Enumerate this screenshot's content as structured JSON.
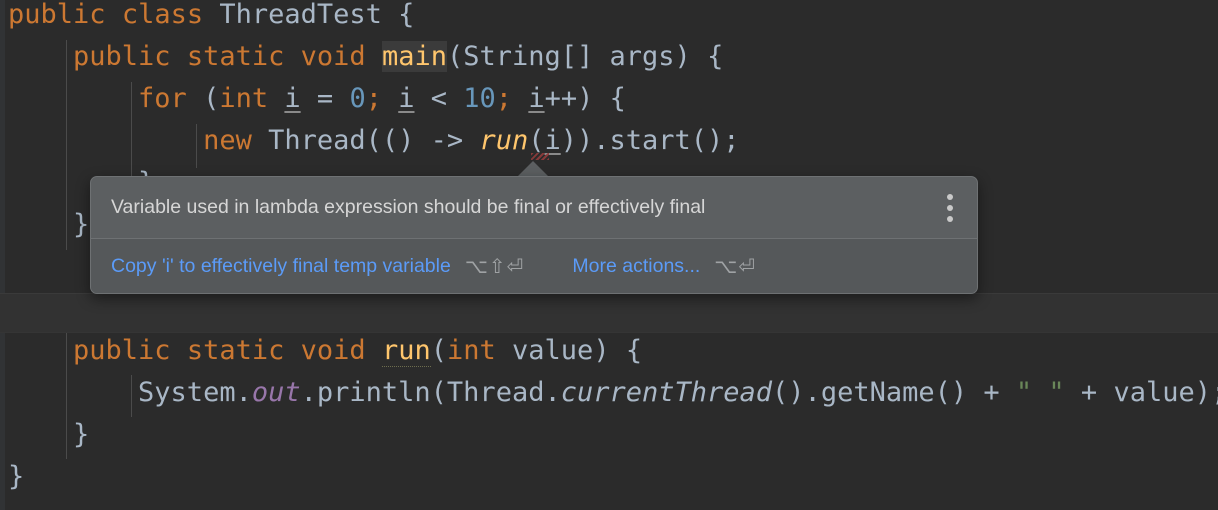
{
  "editor": {
    "background_color": "#2b2b2b",
    "font_size_px": 27,
    "language": "Java",
    "lines": [
      {
        "id": "line-1",
        "indent": 0,
        "text": "public class ThreadTest {"
      },
      {
        "id": "line-2",
        "indent": 1,
        "text": "public static void main(String[] args) {"
      },
      {
        "id": "line-3",
        "indent": 2,
        "text": "for (int i = 0; i < 10; i++) {"
      },
      {
        "id": "line-4",
        "indent": 3,
        "text": "new Thread(() -> run(i)).start();"
      },
      {
        "id": "line-5",
        "indent": 2,
        "text": "}"
      },
      {
        "id": "line-6",
        "indent": 1,
        "text": "}"
      },
      {
        "id": "line-7",
        "indent": 0,
        "text": ""
      },
      {
        "id": "line-8",
        "indent": 1,
        "text": "public static void run(int value) {"
      },
      {
        "id": "line-9",
        "indent": 2,
        "text": "System.out.println(Thread.currentThread().getName() + \" \" + value);"
      },
      {
        "id": "line-10",
        "indent": 1,
        "text": "}"
      },
      {
        "id": "line-11",
        "indent": 0,
        "text": "}"
      }
    ],
    "tokens": {
      "line1": {
        "kw1": "public",
        "kw2": "class",
        "name": "ThreadTest",
        "brace": "{"
      },
      "line2": {
        "kw1": "public",
        "kw2": "static",
        "kw3": "void",
        "method": "main",
        "params": "(String[] args) {"
      },
      "line3": {
        "kw1": "for",
        "open": "(",
        "kw2": "int",
        "var": "i",
        "eq": " = ",
        "num1": "0",
        "semi1": ";",
        "var2": "i",
        "lt": " < ",
        "num2": "10",
        "semi2": ";",
        "var3": "i",
        "inc": "++) {"
      },
      "line4": {
        "kw1": "new",
        "type": "Thread",
        "lambda": "(() -> ",
        "method": "run",
        "arg": "(i)).start();"
      },
      "line8": {
        "kw1": "public",
        "kw2": "static",
        "kw3": "void",
        "method": "run",
        "kw4": "int",
        "param": "value",
        "tail": ") {"
      },
      "line9": {
        "sys": "System.",
        "field": "out",
        "call": ".println(Thread.",
        "static_call": "currentThread",
        "chain": "().getName() + ",
        "string": "\" \"",
        "plus": " + ",
        "value": "value",
        "tail": ");"
      }
    },
    "colors": {
      "keyword": "#cc7832",
      "method": "#ffc66d",
      "number": "#6897bb",
      "string": "#6a8759",
      "field": "#9876aa",
      "plain": "#a9b7c6",
      "error_squiggle": "#8b3a3a",
      "caret_line": "#323232",
      "gutter": "#313335"
    }
  },
  "popup": {
    "name": "intention-action-popup",
    "background_color": "#5c5f61",
    "message": "Variable used in lambda expression should be final or effectively final",
    "kebab_icon": "more-options-vertical-dots-icon",
    "actions": [
      {
        "id": "copy-to-final-temp",
        "label": "Copy 'i' to effectively final temp variable",
        "shortcut": "⌥⇧⏎",
        "color": "#5b9bf8"
      },
      {
        "id": "more-actions",
        "label": "More actions...",
        "shortcut": "⌥⏎",
        "color": "#5b9bf8"
      }
    ]
  }
}
